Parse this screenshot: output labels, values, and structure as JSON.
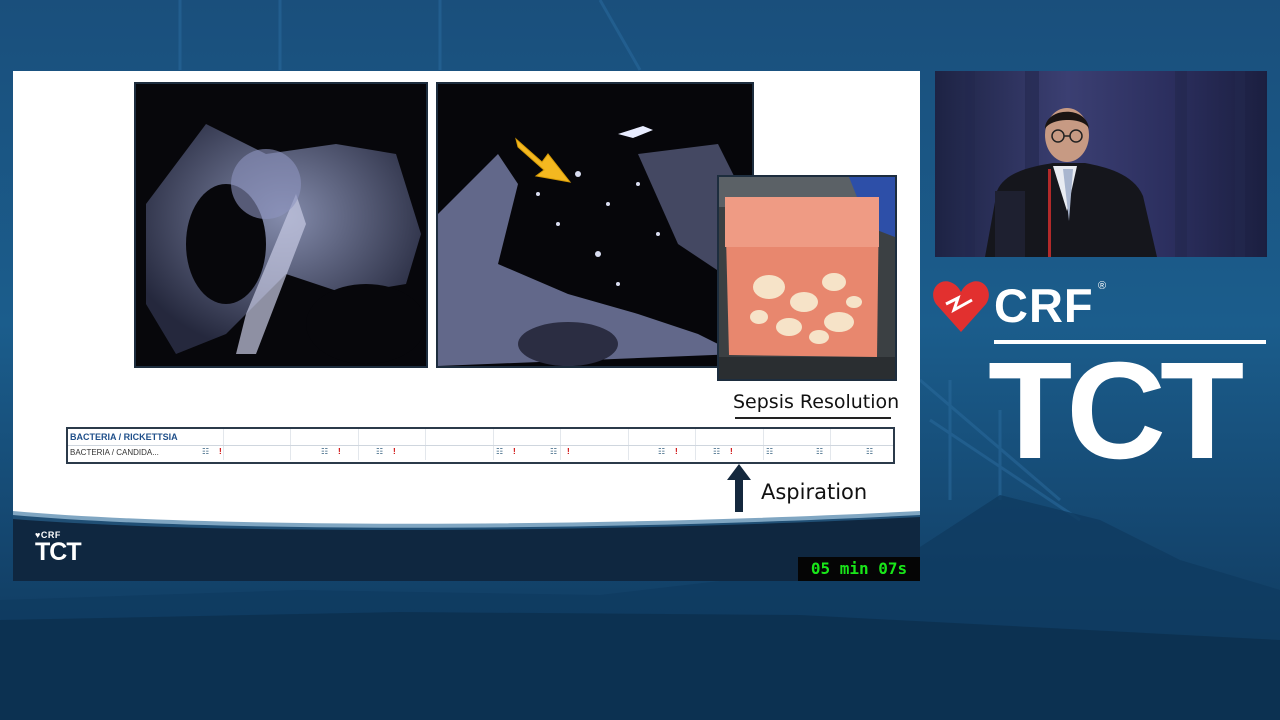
{
  "slide": {
    "annotation_top": "Sepsis Resolution",
    "annotation_bottom": "Aspiration",
    "timeline": {
      "title": "BACTERIA / RICKETTSIA",
      "row_label": "BACTERIA / CANDIDA..."
    },
    "footer_logo": {
      "crf": "CRF",
      "tct": "TCT"
    },
    "timer": "05 min 07s"
  },
  "brand": {
    "crf": "CRF",
    "registered": "®",
    "tct": "TCT"
  },
  "colors": {
    "background_blue": "#1b5d8c",
    "slide_white": "#ffffff",
    "arrow_yellow": "#f4b820",
    "heart_red": "#e2302f",
    "timer_green": "#19e619",
    "footer_navy": "#0f2740"
  },
  "icons": [
    "heart-logo-icon",
    "arrow-up-icon",
    "yellow-arrow-icon"
  ]
}
